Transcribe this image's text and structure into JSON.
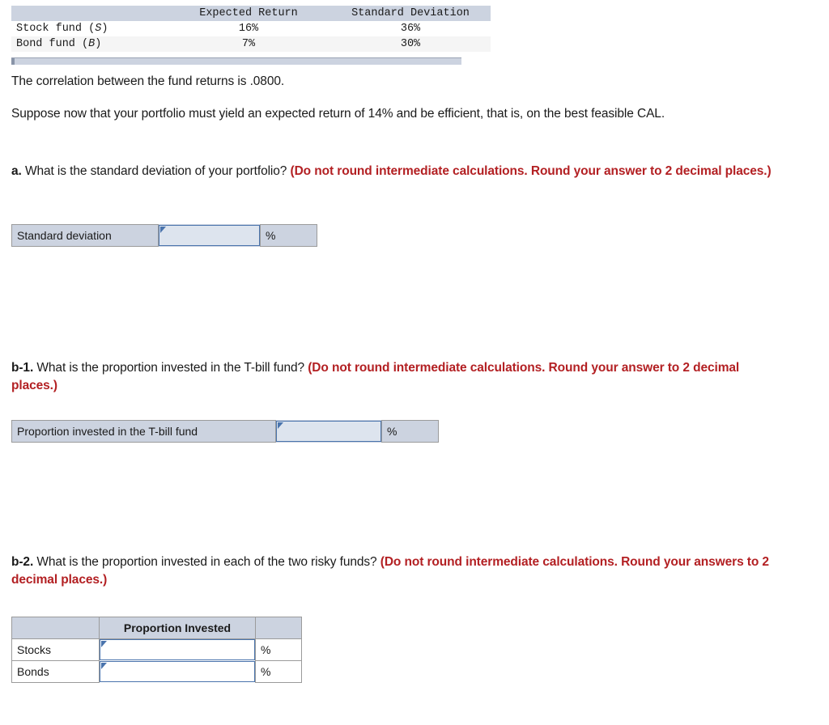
{
  "given_table": {
    "columns": [
      "",
      "Expected Return",
      "Standard Deviation"
    ],
    "rows": [
      {
        "name": "Stock fund (",
        "symbol": "S",
        "name_end": ")",
        "expected_return": "16%",
        "std_dev": "36%"
      },
      {
        "name": "Bond fund (",
        "symbol": "B",
        "name_end": ")",
        "expected_return": "7%",
        "std_dev": "30%"
      }
    ]
  },
  "paragraphs": {
    "correlation": "The correlation between the fund returns is .0800.",
    "suppose": "Suppose now that your portfolio must yield an expected return of 14% and be efficient, that is, on the best feasible CAL."
  },
  "questions": {
    "a": {
      "label": "a.",
      "text": " What is the standard deviation of your portfolio? ",
      "note": "(Do not round intermediate calculations. Round your answer to 2 decimal places.)"
    },
    "b1": {
      "label": "b-1.",
      "text": " What is the proportion invested in the T-bill fund? ",
      "note": "(Do not round intermediate calculations. Round your answer to 2 decimal places.)"
    },
    "b2": {
      "label": "b-2.",
      "text": " What is the proportion invested in each of the two risky funds? ",
      "note": "(Do not round intermediate calculations. Round your answers to 2 decimal places.)"
    }
  },
  "answer_a": {
    "row_label": "Standard deviation",
    "value": "",
    "unit": "%"
  },
  "answer_b1": {
    "row_label": "Proportion invested in the T-bill fund",
    "value": "",
    "unit": "%"
  },
  "answer_b2": {
    "header": [
      "",
      "Proportion Invested",
      ""
    ],
    "rows": [
      {
        "label": "Stocks",
        "value": "",
        "unit": "%"
      },
      {
        "label": "Bonds",
        "value": "",
        "unit": "%"
      }
    ]
  },
  "colors": {
    "header_fill": "#ccd3e0",
    "note_red": "#b32023",
    "input_border": "#4a74ad",
    "input_fill": "#dde4ee"
  }
}
